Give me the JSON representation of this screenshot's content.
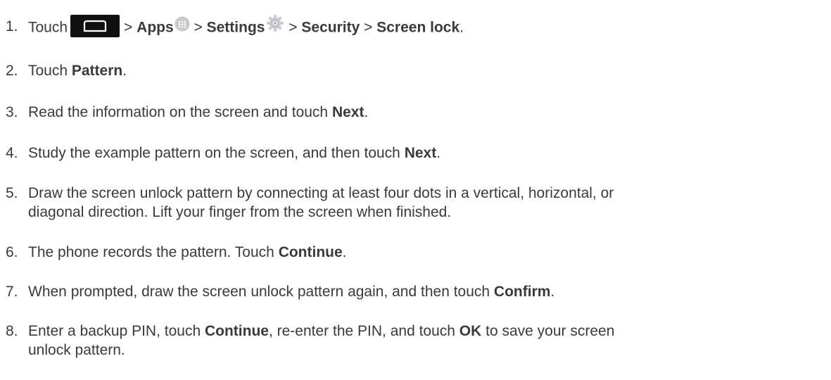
{
  "steps": [
    {
      "num": "1.",
      "parts": {
        "touch": "Touch",
        "sep1": ">",
        "apps": "Apps",
        "sep2": ">",
        "settings": "Settings",
        "sep3": ">",
        "security": "Security",
        "sep4": ">",
        "screen_lock": "Screen lock",
        "end": "."
      }
    },
    {
      "num": "2.",
      "pre": "Touch ",
      "b1": "Pattern",
      "post": "."
    },
    {
      "num": "3.",
      "pre": "Read the information on the screen and touch ",
      "b1": "Next",
      "post": "."
    },
    {
      "num": "4.",
      "pre": "Study the example pattern on the screen, and then touch ",
      "b1": "Next",
      "post": "."
    },
    {
      "num": "5.",
      "line1": "Draw the screen unlock pattern by connecting at least four dots in a vertical, horizontal, or",
      "line2": "diagonal direction. Lift your finger from the screen when finished."
    },
    {
      "num": "6.",
      "pre": "The phone records the pattern. Touch ",
      "b1": "Continue",
      "post": "."
    },
    {
      "num": "7.",
      "pre": "When prompted, draw the screen unlock pattern again, and then touch ",
      "b1": "Confirm",
      "post": "."
    },
    {
      "num": "8.",
      "pre": "Enter a backup PIN, touch ",
      "b1": "Continue",
      "mid": ", re-enter the PIN, and touch ",
      "b2": "OK",
      "post1": " to save your screen",
      "line2": "unlock pattern."
    }
  ],
  "icons": {
    "home": "home-icon",
    "apps": "apps-icon",
    "settings": "settings-gear-icon"
  },
  "colors": {
    "text": "#3a3a3a",
    "apps_icon": "#c9c9c9",
    "settings_icon": "#c8ccd0"
  }
}
